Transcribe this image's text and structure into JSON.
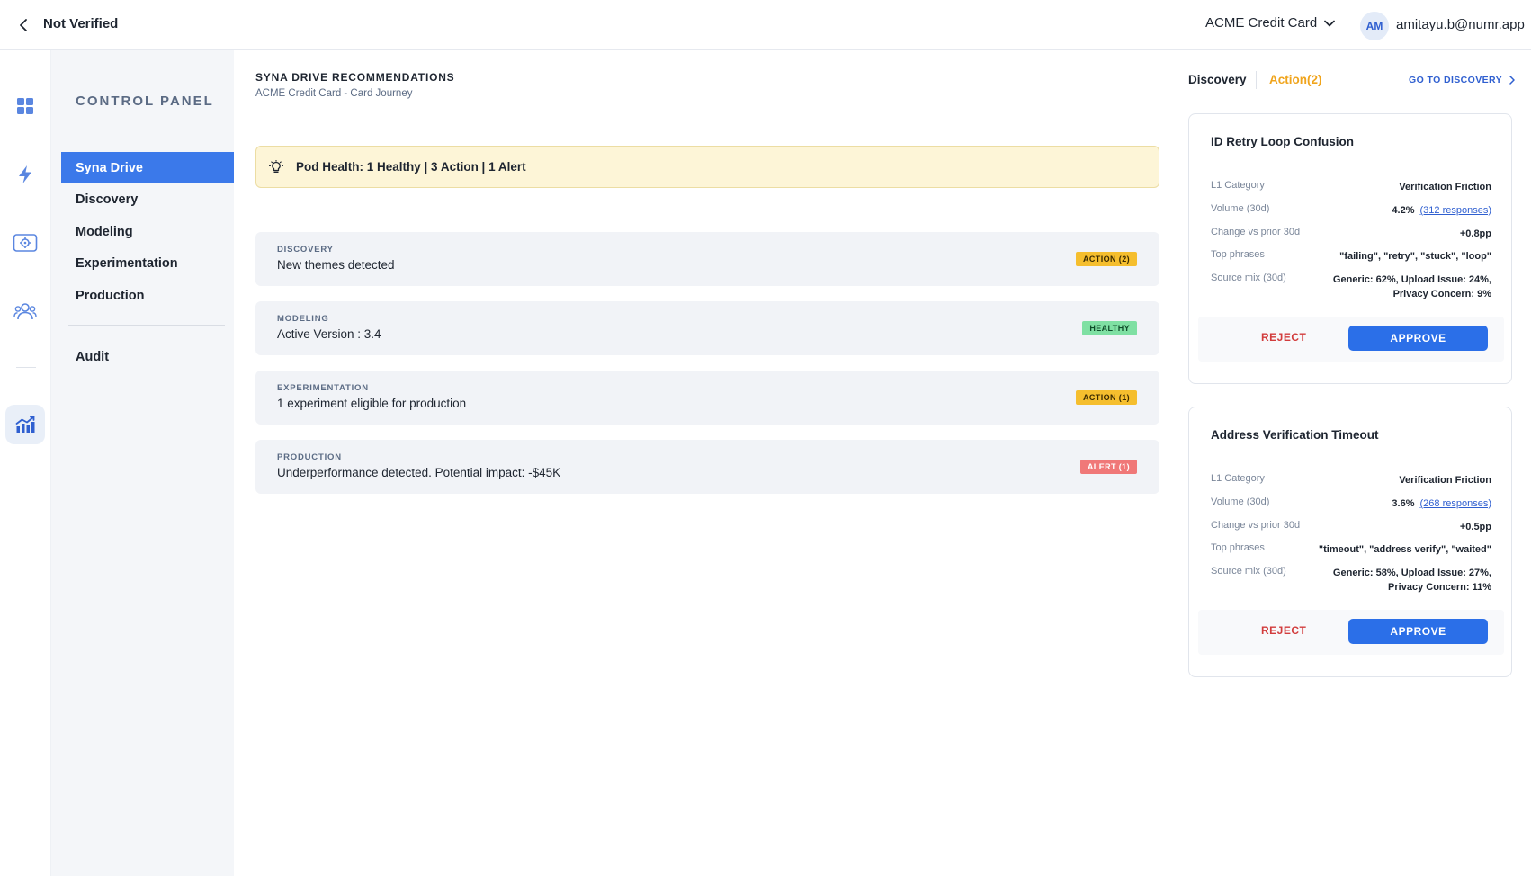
{
  "header": {
    "title": "Not Verified",
    "product": "ACME Credit Card",
    "avatar_initials": "AM",
    "user_email": "amitayu.b@numr.app"
  },
  "rail": {
    "icons": [
      "dashboard-icon",
      "lightning-icon",
      "settings-panel-icon",
      "users-icon",
      "analytics-chart-icon"
    ],
    "active": "analytics-chart-icon"
  },
  "control_panel": {
    "title": "CONTROL PANEL",
    "items": [
      {
        "label": "Syna Drive",
        "active": true
      },
      {
        "label": "Discovery"
      },
      {
        "label": "Modeling"
      },
      {
        "label": "Experimentation"
      },
      {
        "label": "Production"
      }
    ],
    "audit_label": "Audit"
  },
  "main": {
    "heading": "SYNA DRIVE RECOMMENDATIONS",
    "subheading": "ACME Credit Card - Card Journey",
    "health": "Pod Health: 1 Healthy | 3 Action | 1 Alert",
    "cards": [
      {
        "category": "DISCOVERY",
        "description": "New themes detected",
        "badge": "ACTION (2)",
        "badge_type": "action"
      },
      {
        "category": "MODELING",
        "description": "Active Version : 3.4",
        "badge": "HEALTHY",
        "badge_type": "healthy"
      },
      {
        "category": "EXPERIMENTATION",
        "description": "1 experiment eligible for production",
        "badge": "ACTION (1)",
        "badge_type": "action"
      },
      {
        "category": "PRODUCTION",
        "description": "Underperformance detected. Potential impact: -$45K",
        "badge": "ALERT (1)",
        "badge_type": "alert"
      }
    ]
  },
  "right_panel": {
    "tab_discovery": "Discovery",
    "tab_action": "Action(2)",
    "go_link": "GO TO DISCOVERY",
    "labels": {
      "category": "L1 Category",
      "volume": "Volume (30d)",
      "change": "Change vs prior 30d",
      "phrases": "Top phrases",
      "source": "Source mix (30d)"
    },
    "recommendations": [
      {
        "title": "ID Retry Loop Confusion",
        "category": "Verification Friction",
        "volume_pct": "4.2%",
        "volume_link": "(312 responses)",
        "change": "+0.8pp",
        "phrases": "\"failing\", \"retry\", \"stuck\", \"loop\"",
        "source_line1": "Generic: 62%, Upload Issue: 24%,",
        "source_line2": "Privacy Concern: 9%",
        "reject": "REJECT",
        "approve": "APPROVE"
      },
      {
        "title": "Address Verification Timeout",
        "category": "Verification Friction",
        "volume_pct": "3.6%",
        "volume_link": "(268 responses)",
        "change": "+0.5pp",
        "phrases": "\"timeout\", \"address verify\", \"waited\"",
        "source_line1": "Generic: 58%, Upload Issue: 27%,",
        "source_line2": "Privacy Concern: 11%",
        "reject": "REJECT",
        "approve": "APPROVE"
      }
    ]
  },
  "colors": {
    "accent": "#3b79ea",
    "action": "#f5be2e",
    "healthy": "#7fe0a3",
    "alert": "#f07878",
    "banner": "#fdf5d7"
  }
}
